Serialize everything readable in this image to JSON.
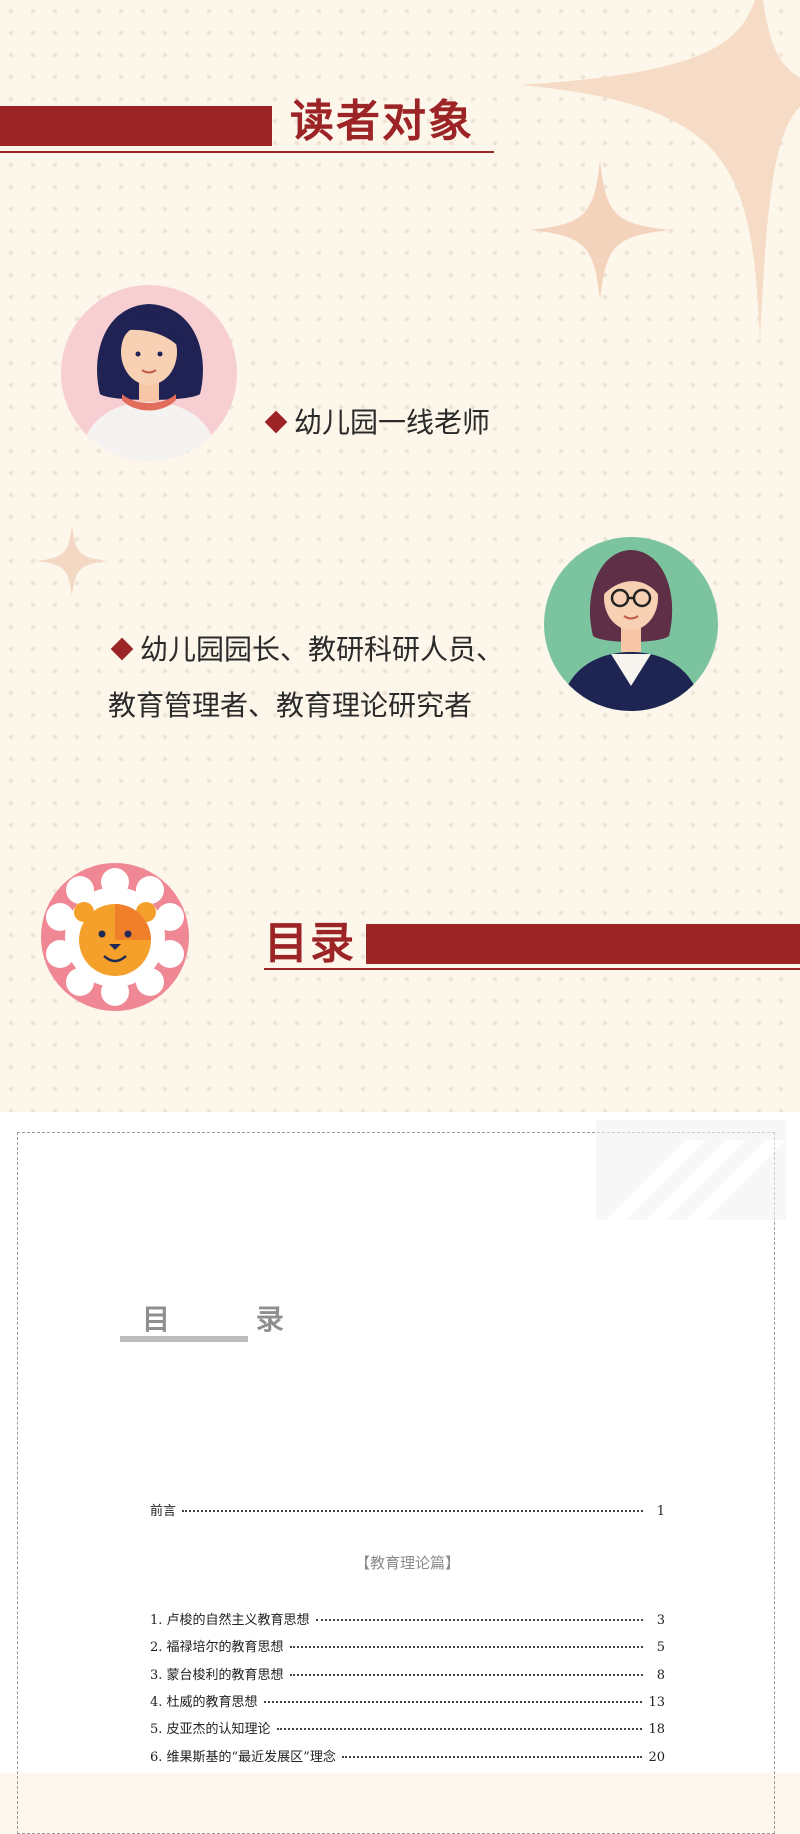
{
  "audience": {
    "title": "读者对象",
    "item1": "幼儿园一线老师",
    "item2_line1": "幼儿园园长、教研科研人员、",
    "item2_line2": "教育管理者、教育理论研究者"
  },
  "contents_heading": "目录",
  "colors": {
    "brand_red": "#9c2426",
    "cream": "#fdf6ea",
    "peach": "#f6dcc6"
  },
  "toc": {
    "title": "目  录",
    "preface": {
      "label": "前言",
      "page": "1"
    },
    "section": "【教育理论篇】",
    "entries": [
      {
        "label": "1. 卢梭的自然主义教育思想",
        "page": "3"
      },
      {
        "label": "2. 福禄培尔的教育思想",
        "page": "5"
      },
      {
        "label": "3. 蒙台梭利的教育思想",
        "page": "8"
      },
      {
        "label": "4. 杜威的教育思想",
        "page": "13"
      },
      {
        "label": "5. 皮亚杰的认知理论",
        "page": "18"
      },
      {
        "label": "6. 维果斯基的“最近发展区”理念",
        "page": "20"
      }
    ]
  },
  "icons": [
    "woman-avatar-icon",
    "teacher-avatar-icon",
    "lion-badge-icon",
    "diamond-bullet-icon",
    "sparkle-star-icon"
  ]
}
